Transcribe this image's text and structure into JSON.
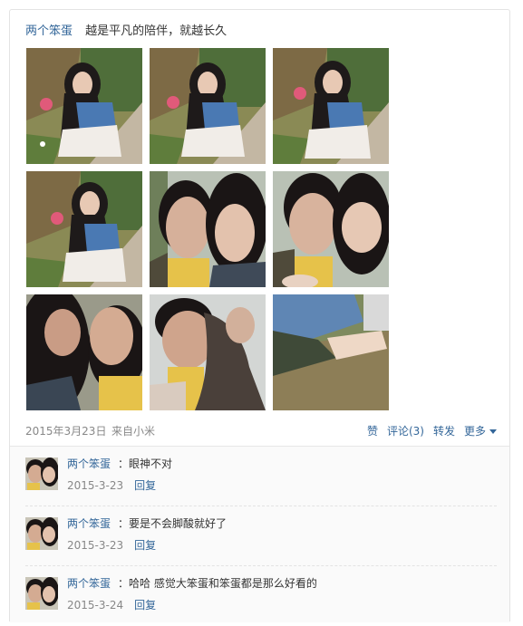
{
  "post": {
    "author": "两个笨蛋",
    "text": "越是平凡的陪伴，就越长久",
    "photos": [
      {
        "icon": "photo-girl-crouching-1"
      },
      {
        "icon": "photo-girl-crouching-2"
      },
      {
        "icon": "photo-girl-crouching-3"
      },
      {
        "icon": "photo-girl-crouching-4"
      },
      {
        "icon": "photo-couple-selfie-1"
      },
      {
        "icon": "photo-couple-selfie-2"
      },
      {
        "icon": "photo-couple-selfie-3"
      },
      {
        "icon": "photo-couple-selfie-4"
      },
      {
        "icon": "photo-hands-grass"
      }
    ],
    "date": "2015年3月23日",
    "source": "来自小米",
    "actions": {
      "like": "赞",
      "comment": "评论(3)",
      "repost": "转发",
      "more": "更多"
    }
  },
  "comments": [
    {
      "author": "两个笨蛋",
      "colon": "：",
      "text": "眼神不对",
      "time": "2015-3-23",
      "reply": "回复"
    },
    {
      "author": "两个笨蛋",
      "colon": "：",
      "text": "要是不会脚酸就好了",
      "time": "2015-3-23",
      "reply": "回复"
    },
    {
      "author": "两个笨蛋",
      "colon": "：",
      "text": "哈哈 感觉大笨蛋和笨蛋都是那么好看的",
      "time": "2015-3-24",
      "reply": "回复"
    }
  ],
  "colors": {
    "link": "#336699",
    "muted": "#888888",
    "text": "#333333"
  }
}
